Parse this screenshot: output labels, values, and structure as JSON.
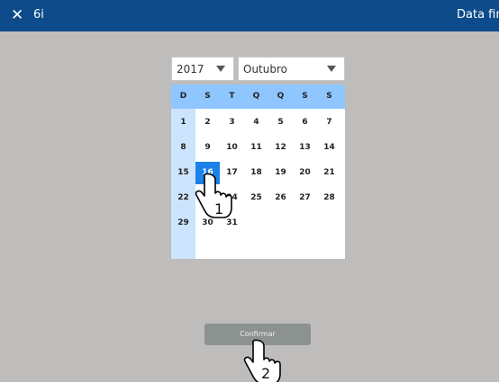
{
  "titlebar": {
    "close_glyph": "✕",
    "doc_number": "6i",
    "title": "Data fina"
  },
  "date_picker": {
    "year": "2017",
    "month": "Outubro",
    "weekdays": [
      "D",
      "S",
      "T",
      "Q",
      "Q",
      "S",
      "S"
    ],
    "days": [
      "1",
      "2",
      "3",
      "4",
      "5",
      "6",
      "7",
      "8",
      "9",
      "10",
      "11",
      "12",
      "13",
      "14",
      "15",
      "16",
      "17",
      "18",
      "19",
      "20",
      "21",
      "22",
      "23",
      "24",
      "25",
      "26",
      "27",
      "28",
      "29",
      "30",
      "31"
    ],
    "selected_day": "16"
  },
  "footer": {
    "confirm_label": "Confirmar"
  },
  "annotations": {
    "step1": "1",
    "step2": "2"
  },
  "colors": {
    "titlebar": "#0d4b8a",
    "background": "#bfbcbc",
    "header": "#8fc6ff",
    "sunday_column": "#cce4fd",
    "selected": "#1a81ea",
    "button": "#8c9290"
  }
}
